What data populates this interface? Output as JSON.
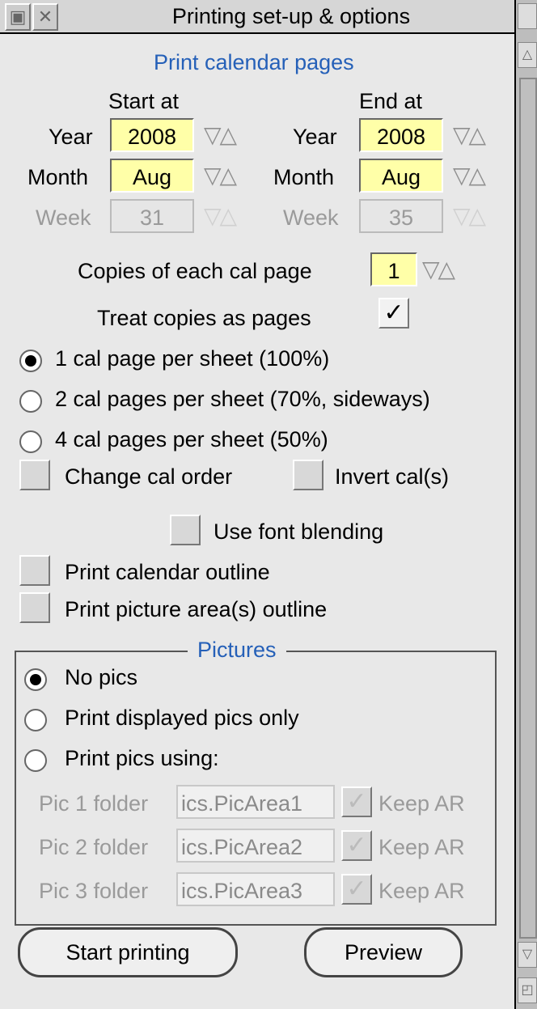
{
  "window": {
    "title": "Printing set-up & options"
  },
  "header": {
    "heading": "Print calendar pages"
  },
  "range": {
    "start": {
      "label": "Start at",
      "year": "2008",
      "month": "Aug",
      "week": "31"
    },
    "end": {
      "label": "End at",
      "year": "2008",
      "month": "Aug",
      "week": "35"
    },
    "year_label": "Year",
    "month_label": "Month",
    "week_label": "Week",
    "stepper_glyph": "▽△"
  },
  "copies": {
    "label": "Copies of each cal page",
    "value": "1"
  },
  "treat_copies": {
    "label": "Treat copies as pages",
    "checked": "✓"
  },
  "layout_options": [
    {
      "label": "1 cal page per sheet (100%)",
      "selected": true
    },
    {
      "label": "2 cal pages per sheet (70%, sideways)",
      "selected": false
    },
    {
      "label": "4 cal pages per sheet (50%)",
      "selected": false
    }
  ],
  "checks": {
    "change_order": "Change cal order",
    "invert": "Invert cal(s)",
    "font_blending": "Use font blending",
    "cal_outline": "Print calendar outline",
    "pic_outline": "Print picture area(s) outline"
  },
  "pictures": {
    "title": "Pictures",
    "options": [
      {
        "label": "No pics",
        "selected": true
      },
      {
        "label": "Print displayed pics only",
        "selected": false
      },
      {
        "label": "Print pics using:",
        "selected": false
      }
    ],
    "folders": [
      {
        "label": "Pic 1 folder",
        "value": "ics.PicArea1",
        "keep_ar": "Keep AR",
        "check": "✓"
      },
      {
        "label": "Pic 2 folder",
        "value": "ics.PicArea2",
        "keep_ar": "Keep AR",
        "check": "✓"
      },
      {
        "label": "Pic 3 folder",
        "value": "ics.PicArea3",
        "keep_ar": "Keep AR",
        "check": "✓"
      }
    ]
  },
  "buttons": {
    "start": "Start printing",
    "preview": "Preview"
  }
}
